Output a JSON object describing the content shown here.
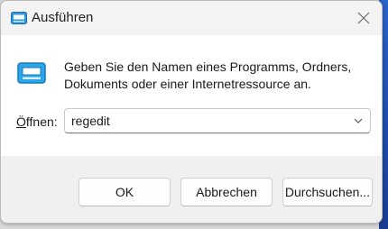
{
  "window": {
    "title": "Ausführen",
    "title_icon": "run-dialog-icon",
    "close_icon": "close-icon"
  },
  "body": {
    "icon": "run-program-icon",
    "description_line1": "Geben Sie den Namen eines Programms, Ordners,",
    "description_line2": "Dokuments oder einer Internetressource an.",
    "open_label": "Öffnen:",
    "open_value": "regedit",
    "dropdown_icon": "chevron-down-icon"
  },
  "buttons": {
    "ok": "OK",
    "cancel": "Abbrechen",
    "browse": "Durchsuchen..."
  },
  "colors": {
    "icon_accent": "#29a4e6",
    "desktop_accent": "#1e4aa8"
  }
}
